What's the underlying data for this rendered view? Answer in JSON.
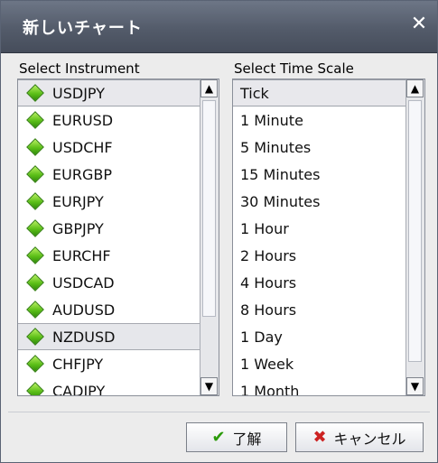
{
  "dialog": {
    "title": "新しいチャート",
    "close_glyph": "✕"
  },
  "instrument_panel": {
    "label": "Select Instrument",
    "items": [
      {
        "label": "USDJPY",
        "selected": true
      },
      {
        "label": "EURUSD"
      },
      {
        "label": "USDCHF"
      },
      {
        "label": "EURGBP"
      },
      {
        "label": "EURJPY"
      },
      {
        "label": "GBPJPY"
      },
      {
        "label": "EURCHF"
      },
      {
        "label": "USDCAD"
      },
      {
        "label": "AUDUSD"
      },
      {
        "label": "NZDUSD",
        "highlighted": true
      },
      {
        "label": "CHFJPY"
      },
      {
        "label": "CADJPY"
      }
    ]
  },
  "timescale_panel": {
    "label": "Select Time Scale",
    "items": [
      {
        "label": "Tick",
        "selected": true
      },
      {
        "label": "1 Minute"
      },
      {
        "label": "5 Minutes"
      },
      {
        "label": "15 Minutes"
      },
      {
        "label": "30 Minutes"
      },
      {
        "label": "1 Hour"
      },
      {
        "label": "2 Hours"
      },
      {
        "label": "4 Hours"
      },
      {
        "label": "8 Hours"
      },
      {
        "label": "1 Day"
      },
      {
        "label": "1 Week"
      },
      {
        "label": "1 Month"
      }
    ]
  },
  "buttons": {
    "ok_label": "了解",
    "cancel_label": "キャンセル",
    "ok_icon": "✔",
    "cancel_icon": "✖"
  },
  "icons": {
    "scroll_up": "▲",
    "scroll_down": "▼"
  }
}
